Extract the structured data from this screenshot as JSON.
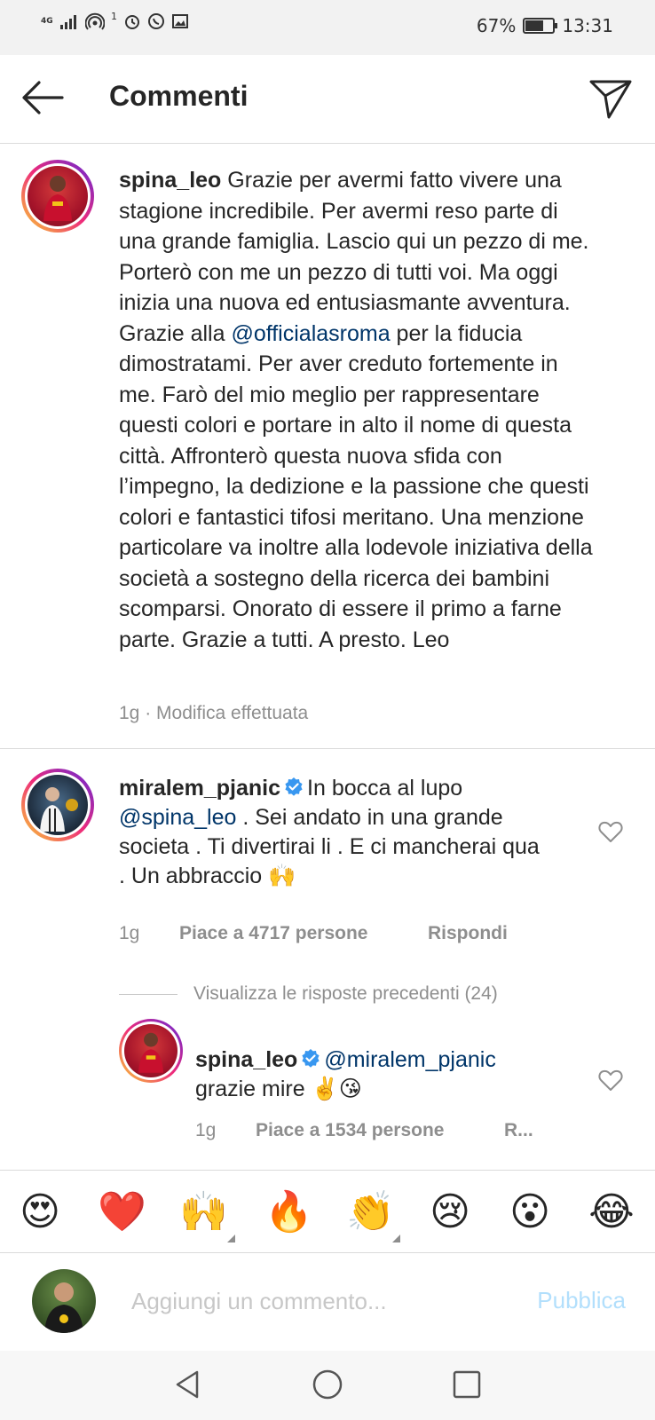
{
  "status_bar": {
    "network": "4G",
    "signal_sub": "1",
    "battery_text": "67%",
    "battery_level": 0.67,
    "time": "13:31"
  },
  "header": {
    "title": "Commenti",
    "back_icon": "back-arrow-icon",
    "send_icon": "direct-send-icon"
  },
  "caption": {
    "username": "spina_leo",
    "text_before_mention": "Grazie per avermi fatto vivere una stagione incredibile. Per avermi reso parte di una grande famiglia. Lascio qui un pezzo di me. Porterò con me un pezzo di tutti voi. Ma oggi inizia una nuova ed entusiasmante  avventura. Grazie alla ",
    "mention": "@officialasroma",
    "text_after_mention": " per la fiducia dimostra­tami. Per aver creduto fortemente in me. Farò del mio meglio per rappresentare questi colori e portare in alto il nome di questa città. Affronterò questa nuova sfida con l’impegno, la dedizione e la pas­sione che questi colori e fantastici tifosi meritano.  Una menzione particolare va inoltre alla lodevole iniziativa della società a sostegno della ricerca dei bambini scomparsi. Onorato di essere il primo a farne parte. Grazie a tutti. A presto. Leo",
    "meta": "1g · Modifica effettuata"
  },
  "comment": {
    "username": "miralem_pjanic",
    "verified": true,
    "text_start": "In bocca al lupo",
    "mention": "@spina_leo",
    "text_end": " . Sei andato in una grande societa . Ti divertirai li . E ci mancherai qua . Un abbraccio 🙌",
    "time": "1g",
    "likes": "Piace a 4717 persone",
    "reply": "Rispondi"
  },
  "view_replies": "Visualizza le risposte precedenti (24)",
  "reply": {
    "username": "spina_leo",
    "verified": true,
    "mention": "@miralem_pjanic",
    "text": "grazie mire ✌️😘",
    "time": "1g",
    "likes": "Piace a 1534 persone",
    "reply_truncated": "R..."
  },
  "emoji_bar": [
    "😍",
    "❤️",
    "🙌",
    "🔥",
    "👏",
    "😢",
    "😮",
    "😂"
  ],
  "composer": {
    "placeholder": "Aggiungi un commento...",
    "publish": "Pubblica"
  },
  "colors": {
    "mention": "#003569",
    "verified_blue": "#3897f0",
    "publish_disabled": "#b2dffc",
    "meta_grey": "#8e8e8e"
  }
}
